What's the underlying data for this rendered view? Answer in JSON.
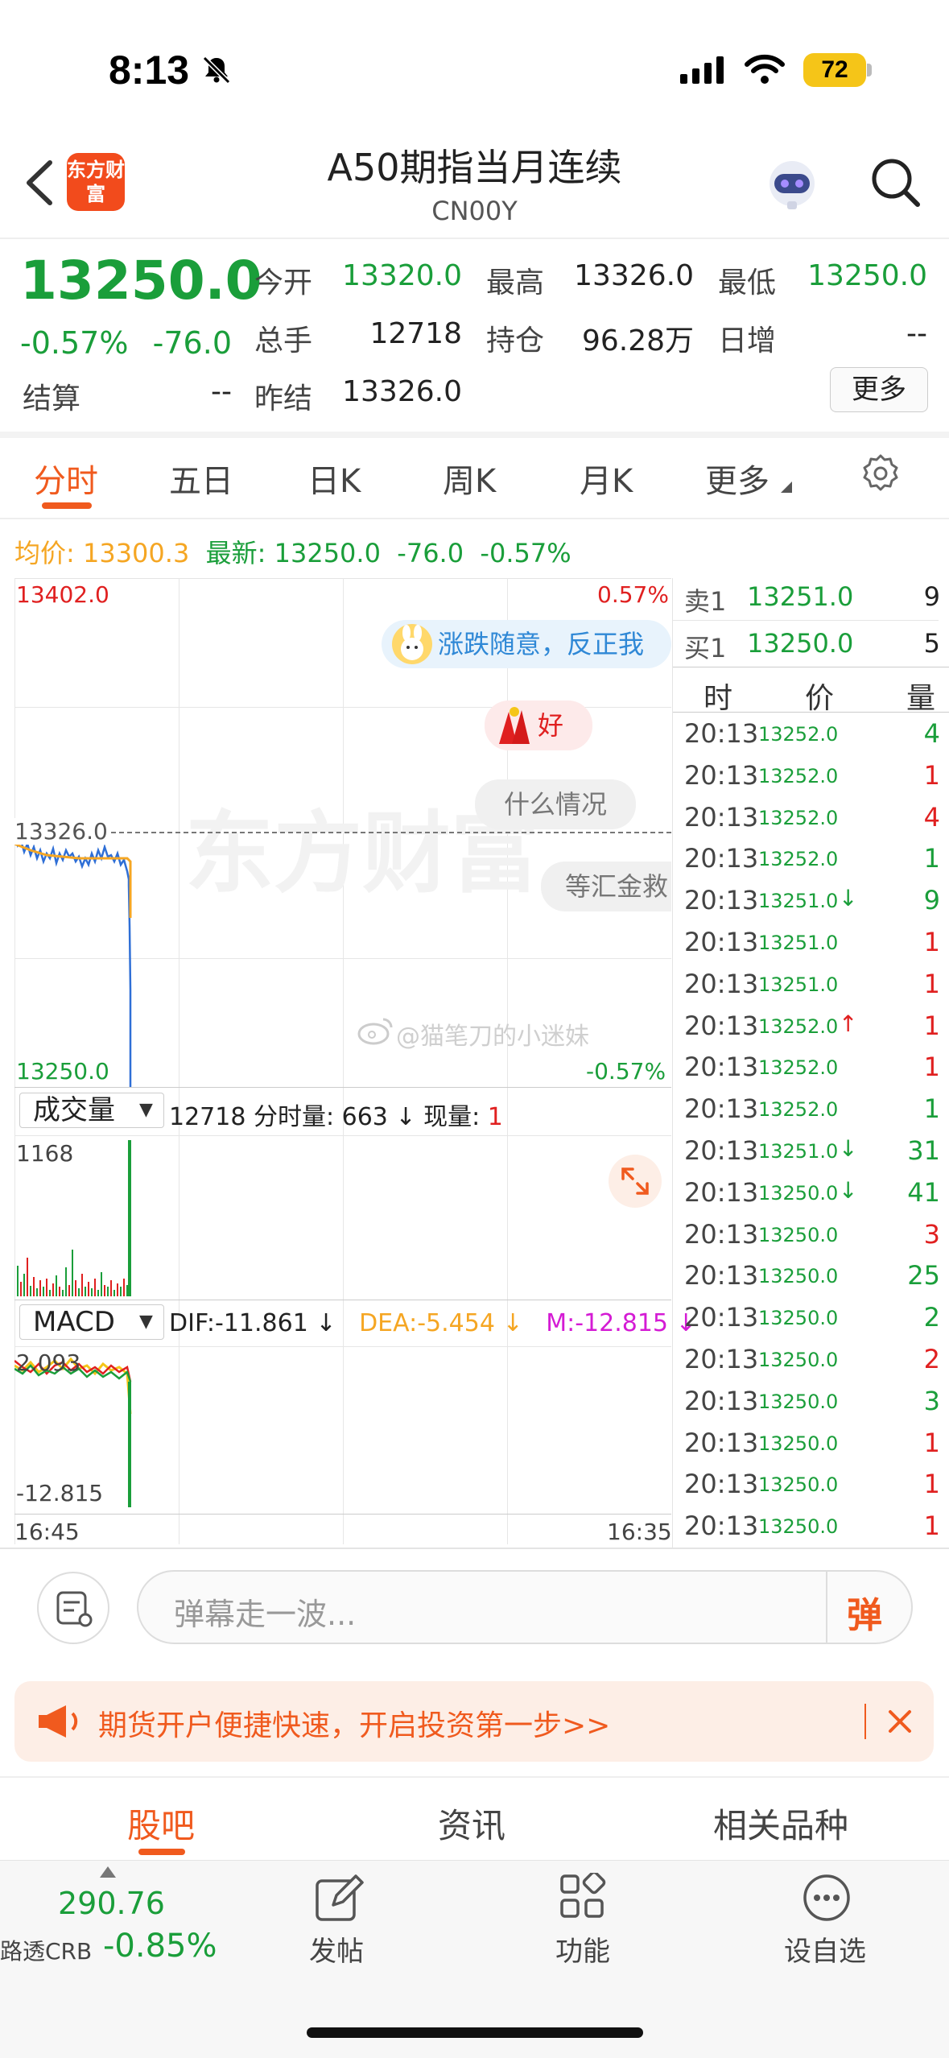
{
  "status": {
    "time": "8:13",
    "battery": "72"
  },
  "header": {
    "logo_text": "东方财富",
    "title": "A50期指当月连续",
    "code": "CN00Y"
  },
  "quote": {
    "price": "13250.0",
    "change_pct": "-0.57%",
    "change": "-76.0",
    "open_label": "今开",
    "open": "13320.0",
    "high_label": "最高",
    "high": "13326.0",
    "low_label": "最低",
    "low": "13250.0",
    "volume_label": "总手",
    "volume": "12718",
    "oi_label": "持仓",
    "oi": "96.28万",
    "daily_inc_label": "日增",
    "daily_inc": "--",
    "settle_label": "结算",
    "settle": "--",
    "prev_settle_label": "昨结",
    "prev_settle": "13326.0",
    "more_label": "更多"
  },
  "tabs": [
    {
      "label": "分时"
    },
    {
      "label": "五日"
    },
    {
      "label": "日K"
    },
    {
      "label": "周K"
    },
    {
      "label": "月K"
    },
    {
      "label": "更多"
    }
  ],
  "info": {
    "avg_label": "均价:",
    "avg": "13300.3",
    "latest_label": "最新:",
    "latest": "13250.0",
    "chg": "-76.0",
    "pct": "-0.57%"
  },
  "chart": {
    "y_high": "13402.0",
    "pct_high": "0.57%",
    "y_ref": "13326.0",
    "y_low": "13250.0",
    "pct_low": "-0.57%",
    "watermark": "东方财富",
    "weibo": "@猫笔刀的小迷妹",
    "danmaku": [
      "涨跌随意，反正我",
      "好",
      "什么情况",
      "等汇金救"
    ],
    "vol_select": "成交量",
    "vol_info_a": "12718 分时量: 663 ↓ 现量: ",
    "vol_info_b": "1",
    "vol_max": "1168",
    "macd_select": "MACD",
    "dif": "DIF:-11.861 ↓",
    "dea": "DEA:-5.454 ↓",
    "m": "M:-12.815 ↓",
    "macd_high": "2.093",
    "macd_low": "-12.815",
    "x_start": "16:45",
    "x_end": "16:35"
  },
  "orderbook": {
    "sell_label": "卖1",
    "sell_price": "13251.0",
    "sell_qty": "9",
    "buy_label": "买1",
    "buy_price": "13250.0",
    "buy_qty": "5",
    "col_time": "时",
    "col_price": "价",
    "col_qty": "量"
  },
  "trades": [
    {
      "time": "20:13",
      "price": "13252.0",
      "qty": "4",
      "qc": "green",
      "arrow": ""
    },
    {
      "time": "20:13",
      "price": "13252.0",
      "qty": "1",
      "qc": "red",
      "arrow": ""
    },
    {
      "time": "20:13",
      "price": "13252.0",
      "qty": "4",
      "qc": "red",
      "arrow": ""
    },
    {
      "time": "20:13",
      "price": "13252.0",
      "qty": "1",
      "qc": "green",
      "arrow": ""
    },
    {
      "time": "20:13",
      "price": "13251.0",
      "qty": "9",
      "qc": "green",
      "arrow": "↓"
    },
    {
      "time": "20:13",
      "price": "13251.0",
      "qty": "1",
      "qc": "red",
      "arrow": ""
    },
    {
      "time": "20:13",
      "price": "13251.0",
      "qty": "1",
      "qc": "red",
      "arrow": ""
    },
    {
      "time": "20:13",
      "price": "13252.0",
      "qty": "1",
      "qc": "red",
      "arrow": "↑"
    },
    {
      "time": "20:13",
      "price": "13252.0",
      "qty": "1",
      "qc": "red",
      "arrow": ""
    },
    {
      "time": "20:13",
      "price": "13252.0",
      "qty": "1",
      "qc": "green",
      "arrow": ""
    },
    {
      "time": "20:13",
      "price": "13251.0",
      "qty": "31",
      "qc": "green",
      "arrow": "↓"
    },
    {
      "time": "20:13",
      "price": "13250.0",
      "qty": "41",
      "qc": "green",
      "arrow": "↓"
    },
    {
      "time": "20:13",
      "price": "13250.0",
      "qty": "3",
      "qc": "red",
      "arrow": ""
    },
    {
      "time": "20:13",
      "price": "13250.0",
      "qty": "25",
      "qc": "green",
      "arrow": ""
    },
    {
      "time": "20:13",
      "price": "13250.0",
      "qty": "2",
      "qc": "green",
      "arrow": ""
    },
    {
      "time": "20:13",
      "price": "13250.0",
      "qty": "2",
      "qc": "red",
      "arrow": ""
    },
    {
      "time": "20:13",
      "price": "13250.0",
      "qty": "3",
      "qc": "green",
      "arrow": ""
    },
    {
      "time": "20:13",
      "price": "13250.0",
      "qty": "1",
      "qc": "red",
      "arrow": ""
    },
    {
      "time": "20:13",
      "price": "13250.0",
      "qty": "1",
      "qc": "red",
      "arrow": ""
    },
    {
      "time": "20:13",
      "price": "13250.0",
      "qty": "1",
      "qc": "red",
      "arrow": ""
    }
  ],
  "comment": {
    "placeholder": "弹幕走一波...",
    "danmaku_btn": "弹"
  },
  "banner": {
    "text": "期货开户便捷快速，开启投资第一步>>"
  },
  "section_tabs": [
    {
      "label": "股吧"
    },
    {
      "label": "资讯"
    },
    {
      "label": "相关品种"
    }
  ],
  "bottom": {
    "index_value": "290.76",
    "index_name": "路透CRB",
    "index_pct": "-0.85%",
    "post": "发帖",
    "func": "功能",
    "fav": "设自选"
  },
  "colors": {
    "accent": "#f05a1e",
    "up": "#e02020",
    "down": "#1a9e3a",
    "price_line": "#2f6fd6",
    "avg_line": "#f5a623"
  }
}
